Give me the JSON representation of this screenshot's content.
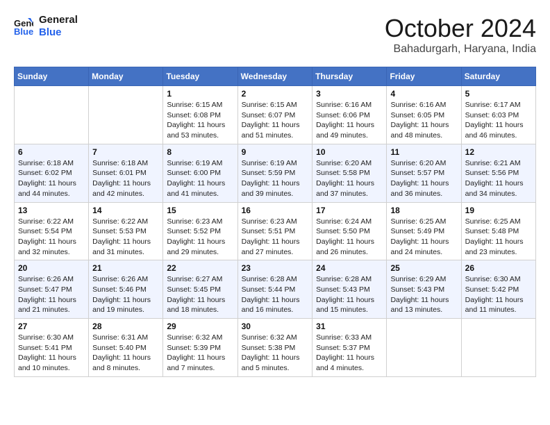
{
  "logo": {
    "line1": "General",
    "line2": "Blue"
  },
  "title": "October 2024",
  "location": "Bahadurgarh, Haryana, India",
  "weekdays": [
    "Sunday",
    "Monday",
    "Tuesday",
    "Wednesday",
    "Thursday",
    "Friday",
    "Saturday"
  ],
  "weeks": [
    [
      {
        "day": "",
        "info": ""
      },
      {
        "day": "",
        "info": ""
      },
      {
        "day": "1",
        "info": "Sunrise: 6:15 AM\nSunset: 6:08 PM\nDaylight: 11 hours and 53 minutes."
      },
      {
        "day": "2",
        "info": "Sunrise: 6:15 AM\nSunset: 6:07 PM\nDaylight: 11 hours and 51 minutes."
      },
      {
        "day": "3",
        "info": "Sunrise: 6:16 AM\nSunset: 6:06 PM\nDaylight: 11 hours and 49 minutes."
      },
      {
        "day": "4",
        "info": "Sunrise: 6:16 AM\nSunset: 6:05 PM\nDaylight: 11 hours and 48 minutes."
      },
      {
        "day": "5",
        "info": "Sunrise: 6:17 AM\nSunset: 6:03 PM\nDaylight: 11 hours and 46 minutes."
      }
    ],
    [
      {
        "day": "6",
        "info": "Sunrise: 6:18 AM\nSunset: 6:02 PM\nDaylight: 11 hours and 44 minutes."
      },
      {
        "day": "7",
        "info": "Sunrise: 6:18 AM\nSunset: 6:01 PM\nDaylight: 11 hours and 42 minutes."
      },
      {
        "day": "8",
        "info": "Sunrise: 6:19 AM\nSunset: 6:00 PM\nDaylight: 11 hours and 41 minutes."
      },
      {
        "day": "9",
        "info": "Sunrise: 6:19 AM\nSunset: 5:59 PM\nDaylight: 11 hours and 39 minutes."
      },
      {
        "day": "10",
        "info": "Sunrise: 6:20 AM\nSunset: 5:58 PM\nDaylight: 11 hours and 37 minutes."
      },
      {
        "day": "11",
        "info": "Sunrise: 6:20 AM\nSunset: 5:57 PM\nDaylight: 11 hours and 36 minutes."
      },
      {
        "day": "12",
        "info": "Sunrise: 6:21 AM\nSunset: 5:56 PM\nDaylight: 11 hours and 34 minutes."
      }
    ],
    [
      {
        "day": "13",
        "info": "Sunrise: 6:22 AM\nSunset: 5:54 PM\nDaylight: 11 hours and 32 minutes."
      },
      {
        "day": "14",
        "info": "Sunrise: 6:22 AM\nSunset: 5:53 PM\nDaylight: 11 hours and 31 minutes."
      },
      {
        "day": "15",
        "info": "Sunrise: 6:23 AM\nSunset: 5:52 PM\nDaylight: 11 hours and 29 minutes."
      },
      {
        "day": "16",
        "info": "Sunrise: 6:23 AM\nSunset: 5:51 PM\nDaylight: 11 hours and 27 minutes."
      },
      {
        "day": "17",
        "info": "Sunrise: 6:24 AM\nSunset: 5:50 PM\nDaylight: 11 hours and 26 minutes."
      },
      {
        "day": "18",
        "info": "Sunrise: 6:25 AM\nSunset: 5:49 PM\nDaylight: 11 hours and 24 minutes."
      },
      {
        "day": "19",
        "info": "Sunrise: 6:25 AM\nSunset: 5:48 PM\nDaylight: 11 hours and 23 minutes."
      }
    ],
    [
      {
        "day": "20",
        "info": "Sunrise: 6:26 AM\nSunset: 5:47 PM\nDaylight: 11 hours and 21 minutes."
      },
      {
        "day": "21",
        "info": "Sunrise: 6:26 AM\nSunset: 5:46 PM\nDaylight: 11 hours and 19 minutes."
      },
      {
        "day": "22",
        "info": "Sunrise: 6:27 AM\nSunset: 5:45 PM\nDaylight: 11 hours and 18 minutes."
      },
      {
        "day": "23",
        "info": "Sunrise: 6:28 AM\nSunset: 5:44 PM\nDaylight: 11 hours and 16 minutes."
      },
      {
        "day": "24",
        "info": "Sunrise: 6:28 AM\nSunset: 5:43 PM\nDaylight: 11 hours and 15 minutes."
      },
      {
        "day": "25",
        "info": "Sunrise: 6:29 AM\nSunset: 5:43 PM\nDaylight: 11 hours and 13 minutes."
      },
      {
        "day": "26",
        "info": "Sunrise: 6:30 AM\nSunset: 5:42 PM\nDaylight: 11 hours and 11 minutes."
      }
    ],
    [
      {
        "day": "27",
        "info": "Sunrise: 6:30 AM\nSunset: 5:41 PM\nDaylight: 11 hours and 10 minutes."
      },
      {
        "day": "28",
        "info": "Sunrise: 6:31 AM\nSunset: 5:40 PM\nDaylight: 11 hours and 8 minutes."
      },
      {
        "day": "29",
        "info": "Sunrise: 6:32 AM\nSunset: 5:39 PM\nDaylight: 11 hours and 7 minutes."
      },
      {
        "day": "30",
        "info": "Sunrise: 6:32 AM\nSunset: 5:38 PM\nDaylight: 11 hours and 5 minutes."
      },
      {
        "day": "31",
        "info": "Sunrise: 6:33 AM\nSunset: 5:37 PM\nDaylight: 11 hours and 4 minutes."
      },
      {
        "day": "",
        "info": ""
      },
      {
        "day": "",
        "info": ""
      }
    ]
  ]
}
